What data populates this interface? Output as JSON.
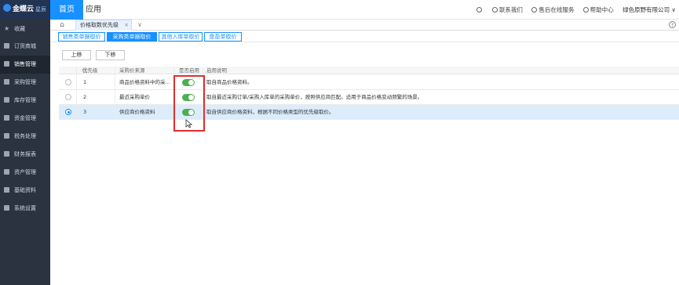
{
  "header": {
    "logo_text": "金蝶云",
    "logo_sub": "星辰",
    "nav": [
      {
        "label": "首页"
      },
      {
        "label": "应用"
      }
    ],
    "right_items": [
      {
        "icon": "search-icon",
        "label": ""
      },
      {
        "icon": "contact-icon",
        "label": "联系我们"
      },
      {
        "icon": "headset-icon",
        "label": "售后在线服务"
      },
      {
        "icon": "help-circle-icon",
        "label": "帮助中心"
      }
    ],
    "company": "绿色原野有限公司"
  },
  "sidebar": {
    "items": [
      {
        "icon": "star-icon",
        "label": "收藏"
      },
      {
        "icon": "cart-icon",
        "label": "订货商城"
      },
      {
        "icon": "sales-icon",
        "label": "销售管理"
      },
      {
        "icon": "purchase-icon",
        "label": "采购管理"
      },
      {
        "icon": "inventory-icon",
        "label": "库存管理"
      },
      {
        "icon": "funds-icon",
        "label": "资金管理"
      },
      {
        "icon": "tax-icon",
        "label": "税务处理"
      },
      {
        "icon": "report-icon",
        "label": "财务报表"
      },
      {
        "icon": "asset-icon",
        "label": "资产管理"
      },
      {
        "icon": "basedata-icon",
        "label": "基础资料"
      },
      {
        "icon": "settings-icon",
        "label": "系统设置"
      }
    ],
    "active_index": 2
  },
  "tabs": {
    "doc_tab": "价格取数优先级",
    "close": "×",
    "more": "∨",
    "help": "?"
  },
  "subtabs": [
    {
      "label": "销售类单据取价"
    },
    {
      "label": "采购类单据取价"
    },
    {
      "label": "其他入库单取价"
    },
    {
      "label": "盘盈单取价"
    }
  ],
  "toolbar": {
    "up": "上移",
    "down": "下移"
  },
  "grid": {
    "columns": {
      "priority": "优先级",
      "source": "采购价来源",
      "enabled": "是否启用",
      "desc": "启用说明"
    },
    "rows": [
      {
        "priority": "1",
        "source": "商品价格资料中的采...",
        "enabled": true,
        "desc": "取自商品价格资料。",
        "selected": false
      },
      {
        "priority": "2",
        "source": "最近采购单价",
        "enabled": true,
        "desc": "取自最近采购订单/采购入库单的采购单价，按照供应商匹配。适用于商品价格变动频繁的场景。",
        "selected": false
      },
      {
        "priority": "3",
        "source": "供应商价格资料",
        "enabled": true,
        "desc": "取自供应商价格资料，根据不同价格类型的优先级取价。",
        "selected": true
      }
    ]
  },
  "colors": {
    "accent": "#1890ff",
    "sidebar": "#2b3340",
    "toggle_on": "#4caf50",
    "highlight": "#e02d2d"
  }
}
